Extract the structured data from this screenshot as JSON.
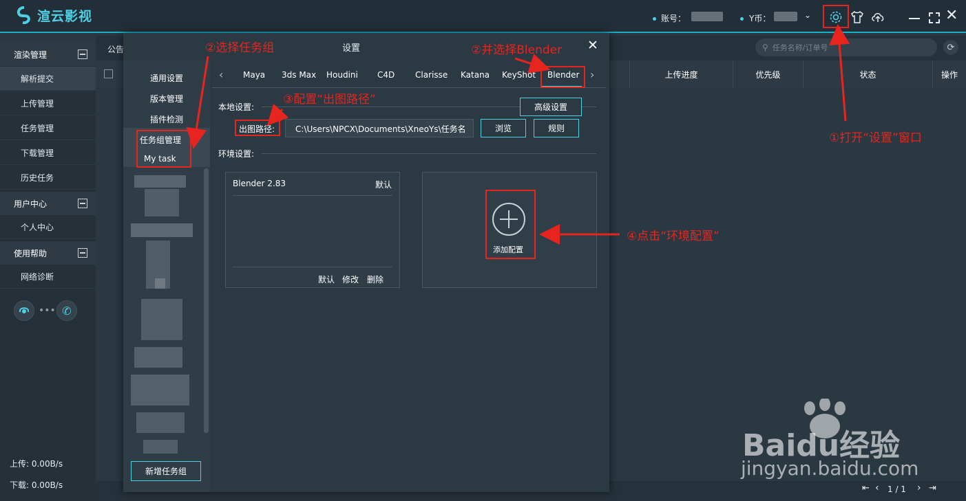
{
  "app": {
    "title": "渲云影视"
  },
  "topbar": {
    "account_label": "账号：",
    "ycoin_label": "Y币："
  },
  "sidebar": {
    "groups": [
      {
        "label": "渲染管理",
        "items": [
          "解析提交",
          "上传管理",
          "任务管理",
          "下载管理",
          "历史任务"
        ]
      },
      {
        "label": "用户中心",
        "items": [
          "个人中心"
        ]
      },
      {
        "label": "使用帮助",
        "items": [
          "网络诊断"
        ]
      }
    ],
    "upload": "上传: 0.00B/s",
    "download": "下载: 0.00B/s"
  },
  "main": {
    "notice_label": "公告",
    "search_placeholder": "任务名称/订单号",
    "columns": [
      "上传进度",
      "优先级",
      "状态",
      "操作"
    ],
    "pagination": "1 / 1"
  },
  "dialog": {
    "title": "设置",
    "left_items": [
      "通用设置",
      "版本管理",
      "插件检测",
      "任务组管理",
      "My task"
    ],
    "new_group_button": "新增任务组",
    "tabs": [
      "Maya",
      "3ds Max",
      "Houdini",
      "C4D",
      "Clarisse",
      "Katana",
      "KeyShot",
      "Blender"
    ],
    "local_settings_label": "本地设置:",
    "advanced_button": "高级设置",
    "output_path_label": "出图路径:",
    "output_path_value": "C:\\Users\\NPCX\\Documents\\XneoYs\\任务名",
    "browse_button": "浏览",
    "rules_button": "规则",
    "env_settings_label": "环境设置:",
    "env_card": {
      "name": "Blender 2.83",
      "default_tag": "默认",
      "actions": [
        "默认",
        "修改",
        "删除"
      ]
    },
    "add_config_label": "添加配置"
  },
  "annotations": {
    "step1": "①打开“设置”窗口",
    "step2a": "②选择任务组",
    "step2b": "②并选择Blender",
    "step3": "③配置“出图路径”",
    "step4": "④点击“环境配置”"
  },
  "watermark": {
    "brand": "Baidu经验",
    "url": "jingyan.baidu.com"
  },
  "colors": {
    "accent": "#4fd0e4",
    "annotation_red": "#e8241f",
    "bg": "#2a3842"
  }
}
